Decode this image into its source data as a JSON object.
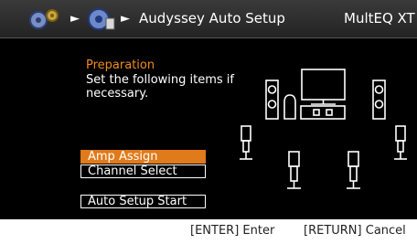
{
  "header": {
    "breadcrumb": "Audyssey Auto Setup",
    "mode": "MultEQ XT",
    "icons": [
      "setup-gear-icon",
      "speaker-setup-icon"
    ],
    "arrow": "►"
  },
  "main": {
    "heading": "Preparation",
    "instruction": "Set the following items if necessary.",
    "menu": [
      {
        "label": "Amp Assign",
        "selected": true
      },
      {
        "label": "Channel Select",
        "selected": false
      },
      {
        "label": "Auto Setup Start",
        "selected": false
      }
    ]
  },
  "footer": {
    "enter_hint": "[ENTER] Enter",
    "return_hint": "[RETURN] Cancel"
  },
  "colors": {
    "highlight": "#e07a1a",
    "heading": "#f08c1e",
    "panel_bg": "#000000"
  }
}
